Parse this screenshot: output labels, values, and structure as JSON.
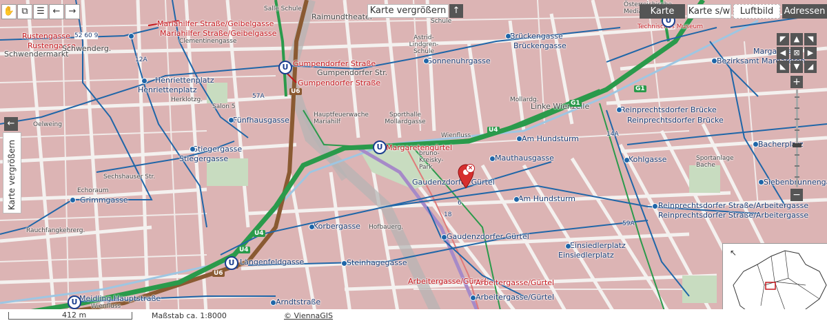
{
  "header": {
    "expand_label": "Karte vergrößern",
    "up_icon": "arrow-up-icon",
    "view_tabs": [
      "Karte",
      "Karte s/w",
      "Luftbild",
      "Adressen"
    ]
  },
  "left_tab": {
    "label": "Karte vergrößern",
    "icon": "arrow-left-icon"
  },
  "toolbar": {
    "icons": [
      "hand-pan-icon",
      "zoom-box-icon",
      "sliders-icon",
      "back-arrow-icon",
      "forward-arrow-icon"
    ]
  },
  "nav": {
    "arrows": [
      "◤",
      "▲",
      "◥",
      "◀",
      "⊠",
      "▶",
      "◣",
      "▼",
      "◢"
    ],
    "zoom_in": "+",
    "zoom_out": "−"
  },
  "scale": {
    "distance": "412 m",
    "ratio": "Maßstab ca. 1:8000",
    "copyright": "© ViennaGIS"
  },
  "colors": {
    "block": "#dcb4b4",
    "street": "#f4f1ef",
    "park": "#c8dcc0",
    "tram": "#1f66a8",
    "u4": "#2a9a4b",
    "u6": "#8a5a32",
    "u3": "#a68ac8",
    "highlight": "#c4161c"
  },
  "labels": {
    "rustengasse": "Rustengasse",
    "rustengasse_line": "52 60 9",
    "rustengasse2": "Rustengasse",
    "schwendermarkt": "Schwendermarkt",
    "schwenderg": "Schwenderg.",
    "mariahilfer1": "Mariahilfer Straße/Geibelgasse",
    "mariahilfer2": "Mariahilfer Straße/Geibelgasse",
    "clementinengasse": "Clementinengasse",
    "raimundtheater": "Raimundtheater",
    "schule": "Schule",
    "sallo": "Salle Schule",
    "gumpendorfer_str": "Gumpendorfer Straße",
    "gumpendorfer_str2": "Gumpendorfer Straße",
    "gumpendorfer_str_road": "Gumpendorfer Str.",
    "astrid": "Astrid-Lindgren-Schule",
    "sonnenuhrgasse": "Sonnenuhrgasse",
    "brueckengasse1": "Brückengasse",
    "brueckengasse2": "Brückengasse",
    "oesterr": "Österreichische Mediathek",
    "technisches": "Technisches Museum",
    "bezirksamt": "Bezirksamt Margareten",
    "margareten": "Margareten",
    "henriettenplatz1": "Henriettenplatz",
    "henriettenplatz2": "Henriettenplatz",
    "herklotzg": "Herklotzg.",
    "salon": "Salon 5",
    "fuenfhausgasse": "Fünfhausgasse",
    "feuerwache": "Hauptfeuerwache Mariahilf",
    "sporthalle": "Sporthalle Mollardgasse",
    "mollardg": "Mollardg.",
    "linke_wienzeile": "Linke Wienzeile",
    "reinprechtsdorfer_bruecke1": "Reinprechtsdorfer Brücke",
    "reinprechtsdorfer_bruecke2": "Reinprechtsdorfer Brücke",
    "oelweing": "Oelweing",
    "braunhirschengasse": "Braunhirschengasse",
    "stiegergasse1": "Stiegergasse",
    "stiegergasse2": "Stiegergasse",
    "sechshauser": "Sechshauser Str.",
    "margaretenguertel1": "Margaretengürtel",
    "margaretenguertel_road": "Margaretengürtel",
    "am_hundsturm1": "Am Hundsturm",
    "am_hundsturm2": "Am Hundsturm",
    "wienfluss": "Wienfluss",
    "bruno": "bruno-Kreisky-Park",
    "mauhausgasse": "Mauthausgasse",
    "gaudenzdorfer1": "Gaudenzdorfer Gürtel",
    "gaudenzdorfer2": "Gaudenzdorfer Gürtel",
    "kohlgasse": "Kohlgasse",
    "bacherplatz": "Bacherplatz",
    "sportanlage": "Sportanlage Bache",
    "siebenbrunnengasse": "Siebenbrunnengasse",
    "echoraum": "Echoraum",
    "grimmgasse": "Grimmgasse",
    "reinprechts_arbeiter1": "Reinprechtsdorfer Straße/Arbeitergasse",
    "reinprechts_arbeiter2": "Reinprechtsdorfer Straße/Arbeitergasse",
    "korbergasse": "Korbergasse",
    "hofbauerg": "Hofbauerg.",
    "rauchfangkehrerg": "Rauchfangkehrerg.",
    "einsiedlerplatz1": "Einsiedlerplatz",
    "einsiedlerplatz2": "Einsiedlerplatz",
    "laengenfeldgasse": "Längenfeldgasse",
    "steinhagegasse": "Steinhagegasse",
    "arbeitergasse_g1": "Arbeitergasse/Gürtel",
    "arbeitergasse_g2": "Arbeitergasse/Gürtel",
    "arbeitergasse_g3": "Arbeitergasse/Gürtel",
    "meidling": "Meidling Hauptstraße",
    "arndtstrasse": "Arndtstraße",
    "wienfluss2": "Wienfluss",
    "u4": "U4",
    "u6": "U6",
    "u": "U",
    "l57a": "57A",
    "l12a": "12A",
    "l14a": "14A",
    "l59a": "59A",
    "g1": "G1",
    "l6": "6",
    "l18": "18"
  }
}
